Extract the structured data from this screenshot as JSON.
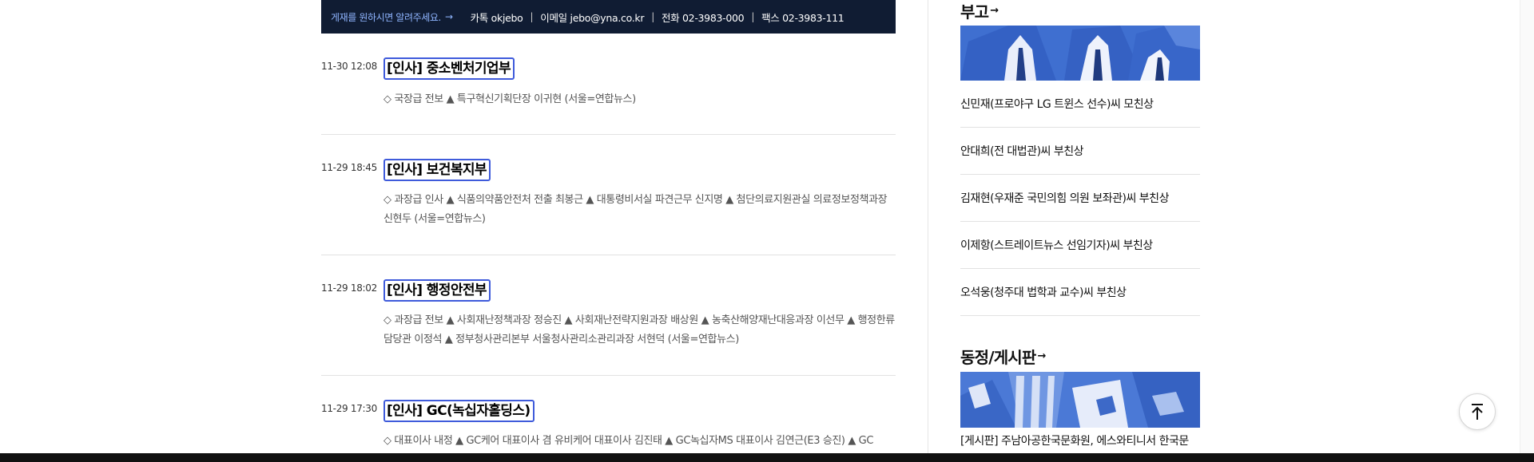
{
  "tip_bar": {
    "cta": "게재를 원하시면 알려주세요.",
    "kakao": "카톡 okjebo",
    "email": "이메일 jebo@yna.co.kr",
    "phone": "전화 02-3983-000",
    "fax": "팩스 02-3983-111"
  },
  "news": [
    {
      "time": "11-30 12:08",
      "title": "[인사] 중소벤처기업부",
      "summary": "◇ 국장급 전보 ▲ 특구혁신기획단장 이귀현 (서울=연합뉴스)"
    },
    {
      "time": "11-29 18:45",
      "title": "[인사] 보건복지부",
      "summary": "◇ 과장급 인사 ▲ 식품의약품안전처 전출 최봉근 ▲ 대통령비서실 파견근무 신지명 ▲ 첨단의료지원관실 의료정보정책과장 신현두 (서울=연합뉴스)"
    },
    {
      "time": "11-29 18:02",
      "title": "[인사] 행정안전부",
      "summary": "◇ 과장급 전보 ▲ 사회재난정책과장 정승진 ▲ 사회재난전략지원과장 배상원 ▲ 농축산해양재난대응과장 이선무 ▲ 행정한류담당관 이정석 ▲ 정부청사관리본부 서울청사관리소관리과장 서현덕 (서울=연합뉴스)"
    },
    {
      "time": "11-29 17:30",
      "title": "[인사] GC(녹십자홀딩스)",
      "summary": "◇ 대표이사 내정 ▲ GC케어 대표이사 겸 유비케어 대표이사 김진태 ▲ GC녹십자MS 대표이사 김연근(E3 승진) ▲ GC"
    }
  ],
  "obituary": {
    "title": "부고",
    "items": [
      "신민재(프로야구 LG 트윈스 선수)씨 모친상",
      "안대희(전 대법관)씨 부친상",
      "김재현(우재준 국민의힘 의원 보좌관)씨 부친상",
      "이제항(스트레이트뉴스 선임기자)씨 부친상",
      "오석웅(청주대 법학과 교수)씨 부친상"
    ]
  },
  "board": {
    "title": "동정/게시판",
    "item": "[게시판] 주남아공한국문화원, 에스와티니서 한국문"
  },
  "colors": {
    "tip_bar_bg": "#101c33",
    "cta_text": "#8fb5ff",
    "title_outline": "#3f5bdb",
    "thumb_tint": "#3f6fd0"
  },
  "icons": {
    "cta": "arrow-right-icon",
    "section_more": "arrow-right-icon",
    "scroll_top": "arrow-up-to-line-icon"
  }
}
